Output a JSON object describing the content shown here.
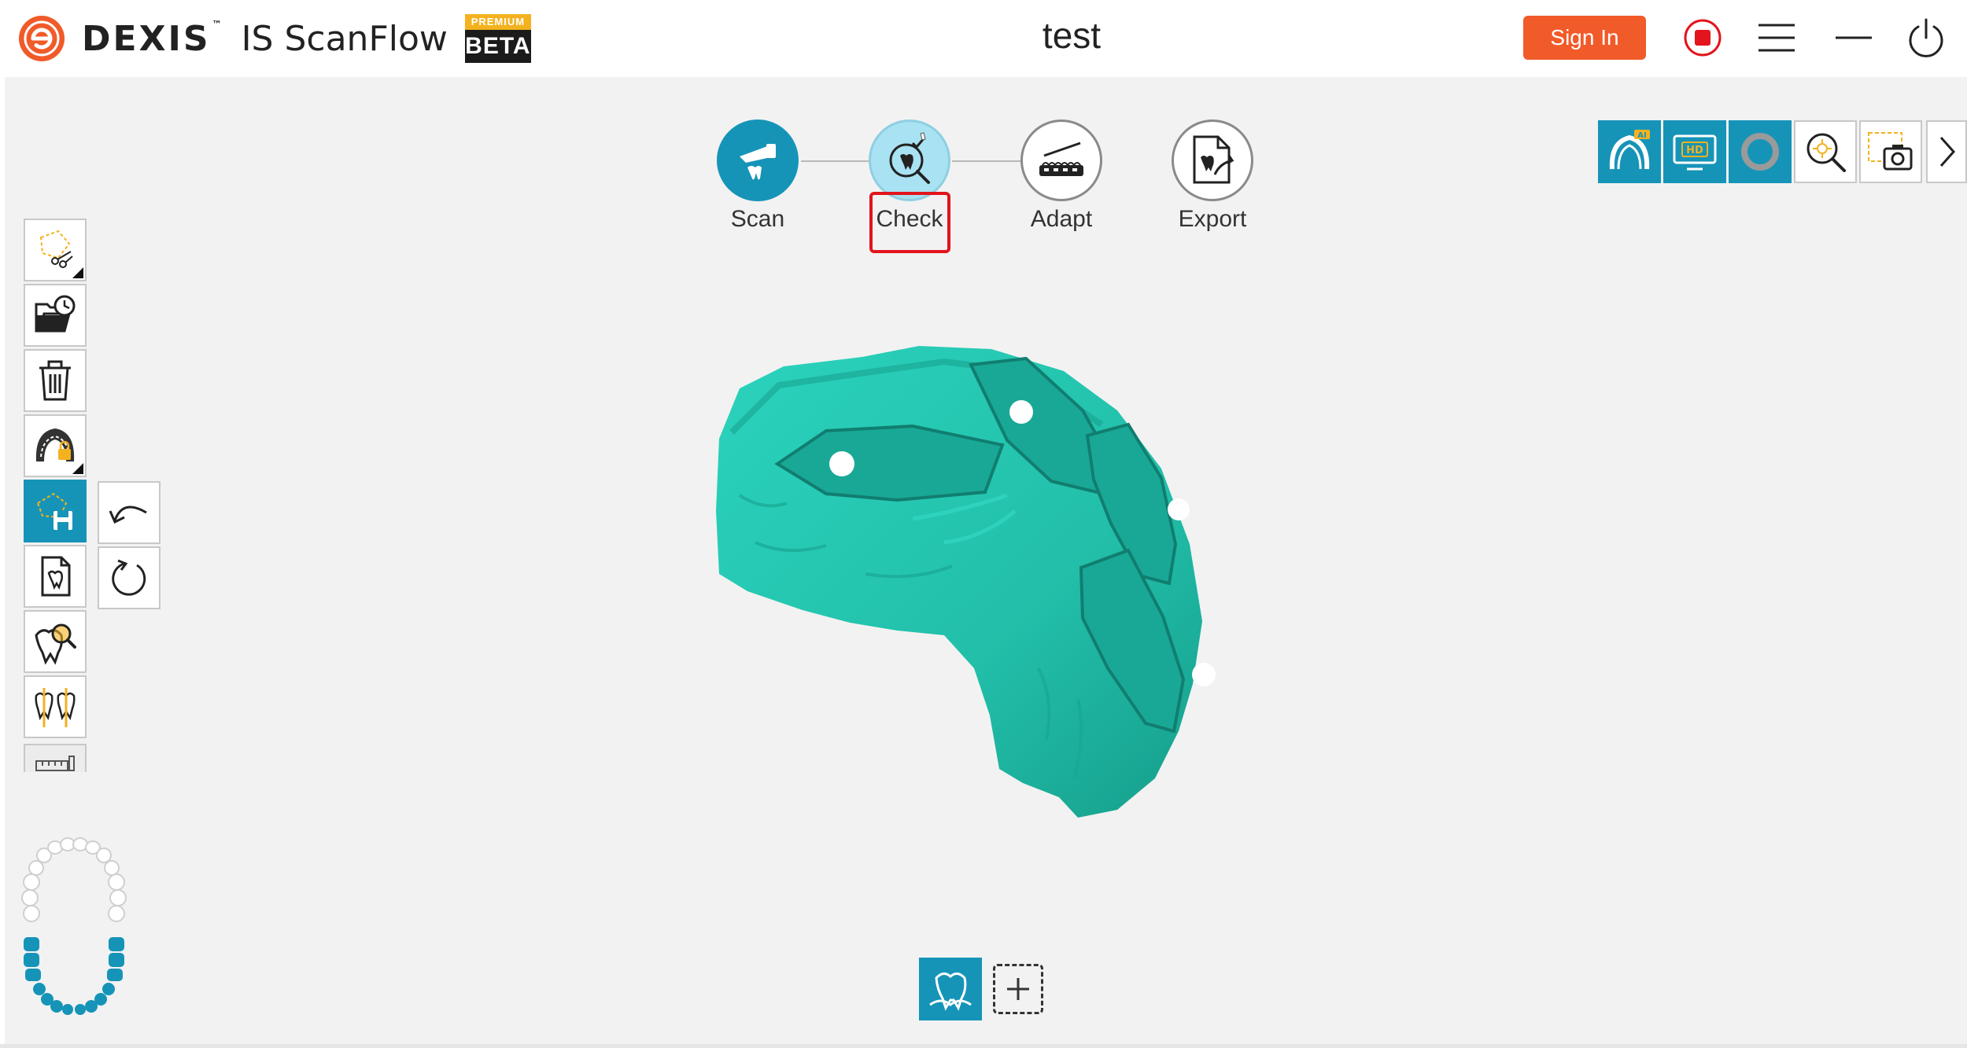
{
  "app": {
    "brand_name": "DEXIS",
    "brand_tm": "™",
    "product_name": "IS ScanFlow",
    "badge_top": "PREMIUM",
    "badge_bottom": "BETA",
    "document_title": "test",
    "sign_in_label": "Sign In"
  },
  "titlebar_icons": [
    "record-stop-icon",
    "menu-icon",
    "minimize-icon",
    "power-icon"
  ],
  "workflow": {
    "steps": [
      {
        "label": "Scan",
        "icon": "scanner-icon",
        "state": "active"
      },
      {
        "label": "Check",
        "icon": "tooth-magnifier-icon",
        "state": "current"
      },
      {
        "label": "Adapt",
        "icon": "adapt-tray-icon",
        "state": "idle"
      },
      {
        "label": "Export",
        "icon": "export-document-icon",
        "state": "idle"
      }
    ],
    "highlighted_step": "Check"
  },
  "right_toolbar": [
    {
      "icon": "ai-arch-icon",
      "badge": "AI",
      "state": "on"
    },
    {
      "icon": "hd-display-icon",
      "badge": "HD",
      "state": "on"
    },
    {
      "icon": "ring-icon",
      "state": "on"
    },
    {
      "icon": "zoom-fit-icon",
      "state": "off"
    },
    {
      "icon": "screenshot-camera-icon",
      "state": "off"
    },
    {
      "icon": "chevron-right-icon",
      "state": "off"
    }
  ],
  "left_toolbar": [
    {
      "icon": "lasso-cut-icon",
      "has_submenu": true,
      "state": "off"
    },
    {
      "icon": "history-folder-icon",
      "has_submenu": false,
      "state": "off"
    },
    {
      "icon": "trash-icon",
      "has_submenu": false,
      "state": "off"
    },
    {
      "icon": "arch-lock-icon",
      "has_submenu": true,
      "state": "off"
    },
    {
      "icon": "save-selection-icon",
      "has_submenu": false,
      "state": "on"
    },
    {
      "icon": "tooth-document-icon",
      "has_submenu": false,
      "state": "off"
    },
    {
      "icon": "tooth-search-icon",
      "has_submenu": false,
      "state": "off"
    },
    {
      "icon": "occlusion-icon",
      "has_submenu": false,
      "state": "off"
    },
    {
      "icon": "ruler-icon",
      "has_submenu": false,
      "state": "off"
    }
  ],
  "side_tools": [
    {
      "icon": "undo-icon"
    },
    {
      "icon": "rotate-icon"
    }
  ],
  "jaw_map": {
    "upper_selected": false,
    "lower_selected": true
  },
  "bottom_tools": [
    {
      "icon": "lower-jaw-tooth-icon",
      "state": "on"
    },
    {
      "icon": "add-jaw-icon",
      "state": "off"
    }
  ],
  "colors": {
    "accent": "#1694b8",
    "current_step": "#a9e2f2",
    "sign_in": "#f15a29",
    "highlight": "#e3141c",
    "model": "#25c7b1",
    "badge_gold": "#f3b21e"
  }
}
